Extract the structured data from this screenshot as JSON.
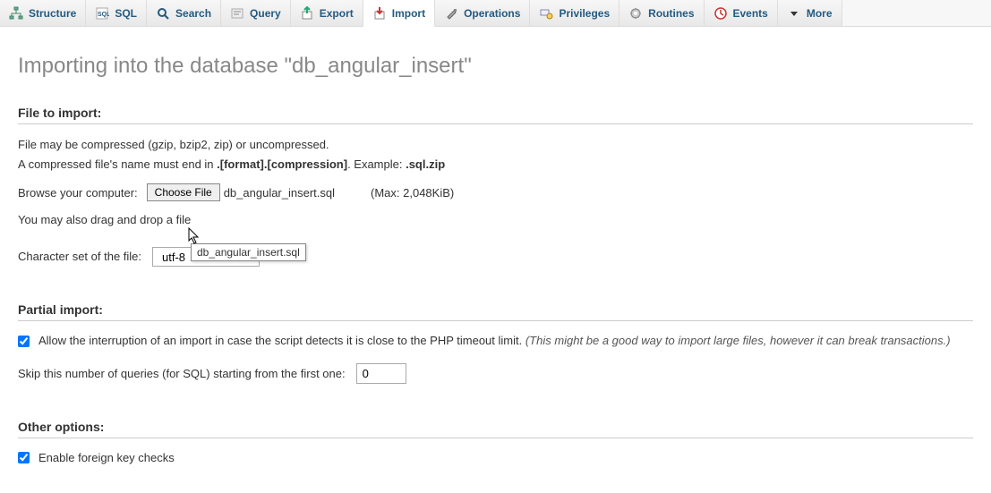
{
  "tabs": [
    {
      "label": "Structure",
      "icon": "structure"
    },
    {
      "label": "SQL",
      "icon": "sql"
    },
    {
      "label": "Search",
      "icon": "search"
    },
    {
      "label": "Query",
      "icon": "query"
    },
    {
      "label": "Export",
      "icon": "export"
    },
    {
      "label": "Import",
      "icon": "import",
      "active": true
    },
    {
      "label": "Operations",
      "icon": "operations"
    },
    {
      "label": "Privileges",
      "icon": "privileges"
    },
    {
      "label": "Routines",
      "icon": "routines"
    },
    {
      "label": "Events",
      "icon": "events"
    },
    {
      "label": "More",
      "icon": "more"
    }
  ],
  "page_title": "Importing into the database \"db_angular_insert\"",
  "file_section": {
    "heading": "File to import:",
    "compress_line1": "File may be compressed (gzip, bzip2, zip) or uncompressed.",
    "compress_line2a": "A compressed file's name must end in ",
    "compress_line2b": ".[format].[compression]",
    "compress_line2c": ". Example: ",
    "compress_line2d": ".sql.zip",
    "browse_label": "Browse your computer:",
    "choose_btn": "Choose File",
    "chosen_file": "db_angular_insert.sql",
    "max_size": "(Max: 2,048KiB)",
    "drag_text": "You may also drag and drop a file",
    "charset_label": "Character set of the file:",
    "charset_value": "utf-8",
    "tooltip": "db_angular_insert.sql"
  },
  "partial_section": {
    "heading": "Partial import:",
    "allow_checked": true,
    "allow_text": "Allow the interruption of an import in case the script detects it is close to the PHP timeout limit. ",
    "allow_note": "(This might be a good way to import large files, however it can break transactions.)",
    "skip_label": "Skip this number of queries (for SQL) starting from the first one:",
    "skip_value": "0"
  },
  "other_section": {
    "heading": "Other options:",
    "fk_checked": true,
    "fk_label": "Enable foreign key checks"
  }
}
